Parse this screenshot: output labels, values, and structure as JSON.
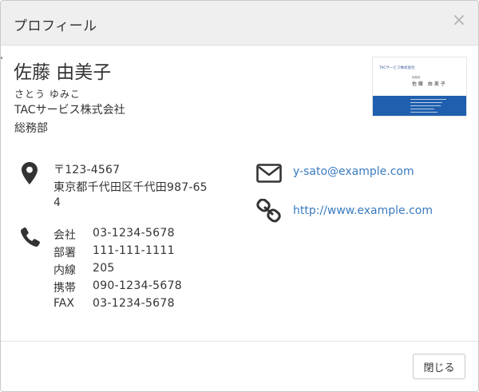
{
  "dialog": {
    "title": "プロフィール",
    "close_glyph": "×"
  },
  "profile": {
    "name": "佐藤 由美子",
    "kana": "さとう ゆみこ",
    "company": "TACサービス株式会社",
    "department": "総務部"
  },
  "business_card": {
    "company": "TACサービス株式会社",
    "role": "総務部",
    "name": "佐藤 由美子"
  },
  "address": {
    "lines": [
      "〒123-4567",
      "東京都千代田区千代田987-65",
      "4"
    ]
  },
  "phones": [
    {
      "label": "会社",
      "value": "03-1234-5678"
    },
    {
      "label": "部署",
      "value": "111-111-1111"
    },
    {
      "label": "内線",
      "value": "205"
    },
    {
      "label": "携帯",
      "value": "090-1234-5678"
    },
    {
      "label": "FAX",
      "value": "03-1234-5678"
    }
  ],
  "contact": {
    "email": "y-sato@example.com",
    "website": "http://www.example.com"
  },
  "footer": {
    "close_label": "閉じる"
  },
  "colors": {
    "link": "#3a7bbf",
    "card_band": "#1f5fae",
    "header_bg": "#efefef"
  }
}
